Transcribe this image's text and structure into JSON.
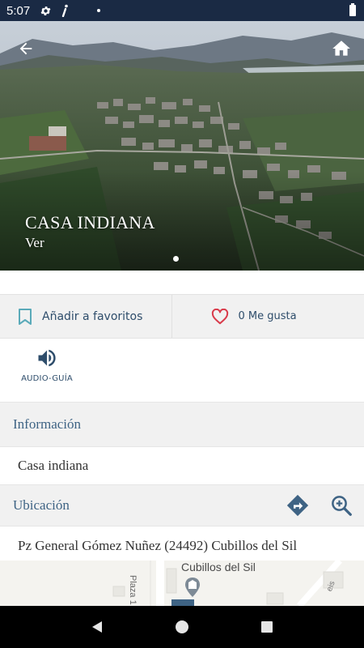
{
  "status_bar": {
    "time": "5:07",
    "icons": [
      "gear-icon",
      "info-italic-icon",
      "notification-dot",
      "battery-icon"
    ]
  },
  "hero": {
    "title": "CASA INDIANA",
    "subtitle": "Ver",
    "back_icon": "arrow-left-icon",
    "home_icon": "home-icon",
    "pager_count": 1
  },
  "actions": {
    "favorites_label": "Añadir a favoritos",
    "likes_label": "0 Me gusta"
  },
  "audio_guide": {
    "label": "AUDIO-GUÍA",
    "icon": "speaker-icon"
  },
  "info": {
    "header": "Información",
    "body": "Casa indiana"
  },
  "location": {
    "header": "Ubicación",
    "address": "Pz General Gómez Nuñez (24492) Cubillos del Sil",
    "directions_icon": "directions-icon",
    "zoom_icon": "zoom-in-icon"
  },
  "map": {
    "place_label": "Cubillos del Sil",
    "street_label": "Plaza 1",
    "street_label_2": "eis"
  },
  "colors": {
    "status_bar": "#1a2a44",
    "accent": "#2e4d6b",
    "section_header_text": "#3e6384",
    "heart": "#d93a4a",
    "section_bg": "#f1f1f1"
  }
}
